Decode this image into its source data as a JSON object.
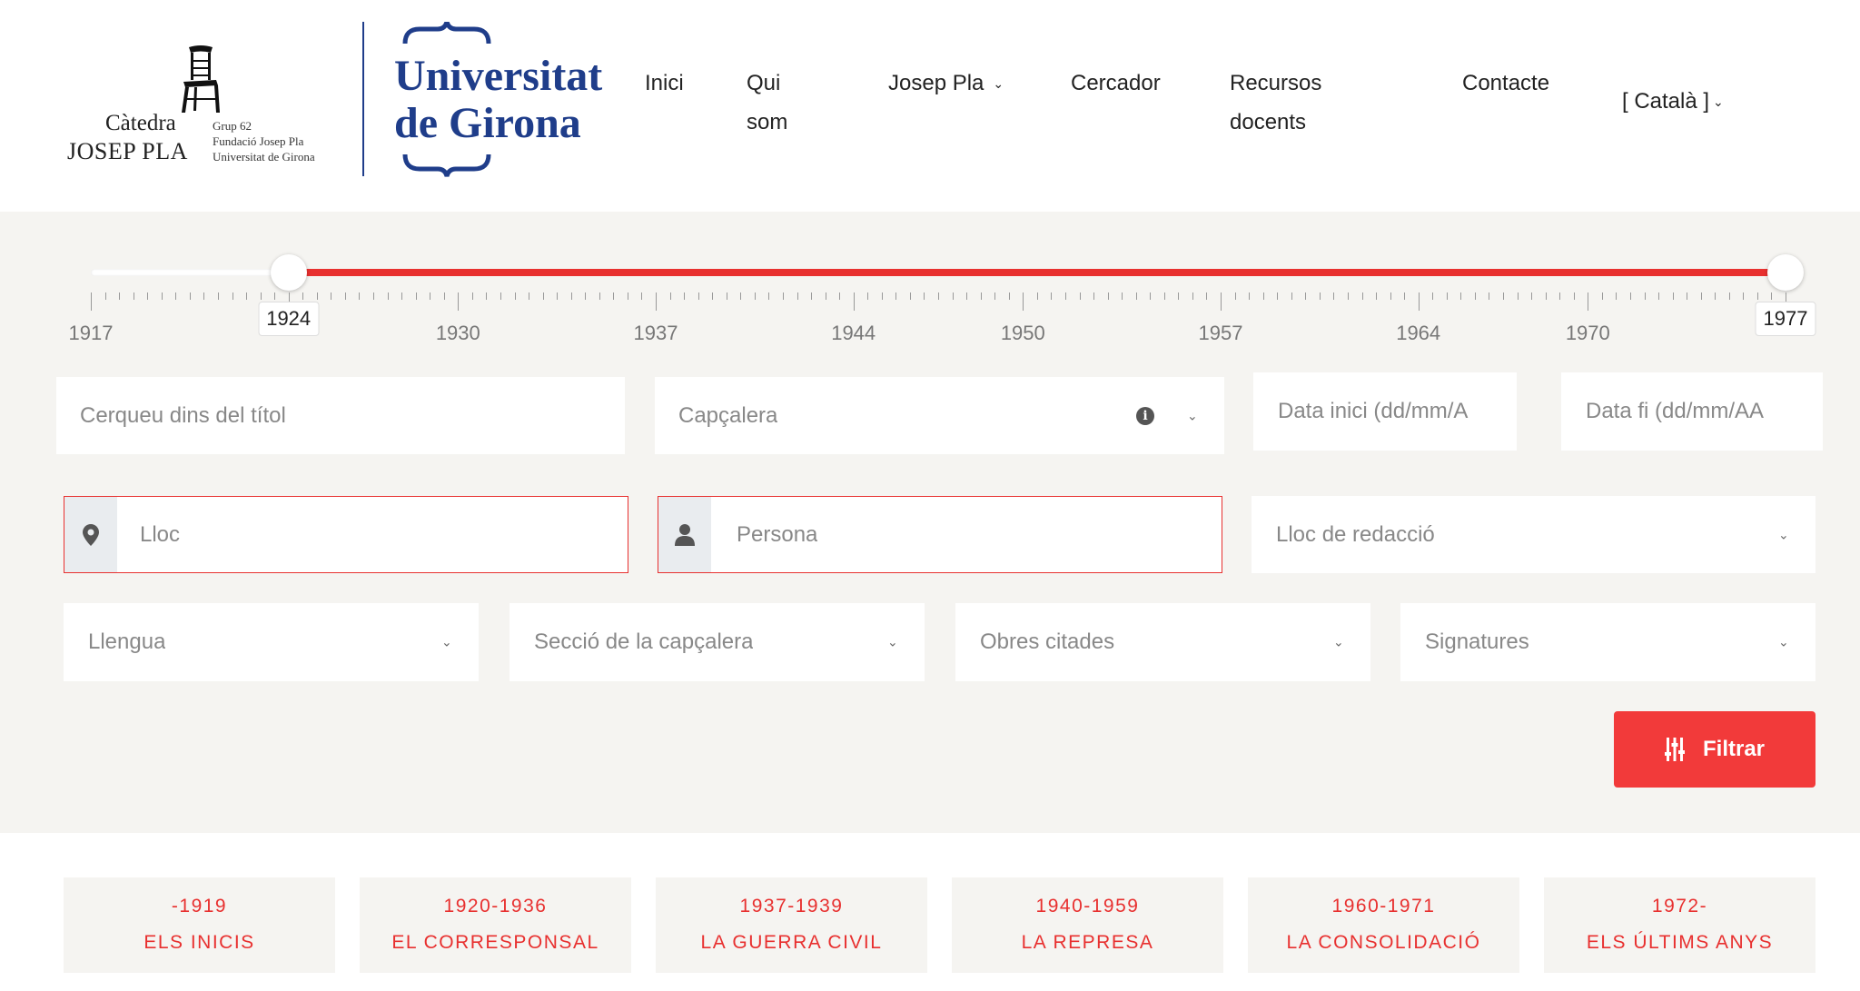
{
  "header": {
    "catedra": {
      "title": "Càtedra",
      "name": "JOSEP PLA",
      "sub_lines": [
        "Grup 62",
        "Fundació Josep Pla",
        "Universitat de Girona"
      ]
    },
    "university": {
      "line1": "Universitat",
      "line2": "de Girona"
    },
    "nav": [
      {
        "label": "Inici"
      },
      {
        "label_line1": "Qui",
        "label_line2": "som"
      },
      {
        "label": "Josep Pla"
      },
      {
        "label": "Cercador"
      },
      {
        "label_line1": "Recursos",
        "label_line2": "docents"
      },
      {
        "label": "Contacte"
      }
    ],
    "language": "[ Català ]"
  },
  "timeline": {
    "min": 1917,
    "max": 1977,
    "selected_from": 1924,
    "selected_to": 1977,
    "tick_labels": [
      "1917",
      "1924",
      "1930",
      "1937",
      "1944",
      "1950",
      "1957",
      "1964",
      "1970",
      "1977"
    ],
    "from_label": "1924",
    "to_label": "1977",
    "accent_color": "#e8302f"
  },
  "filters": {
    "title_search": {
      "placeholder": "Cerqueu dins del títol"
    },
    "header_select": {
      "placeholder": "Capçalera"
    },
    "date_start": {
      "placeholder": "Data inici (dd/mm/A"
    },
    "date_end": {
      "placeholder": "Data fi (dd/mm/AA"
    },
    "place": {
      "placeholder": "Lloc"
    },
    "person": {
      "placeholder": "Persona"
    },
    "writing_place": {
      "placeholder": "Lloc de redacció"
    },
    "language": {
      "placeholder": "Llengua"
    },
    "section": {
      "placeholder": "Secció de la capçalera"
    },
    "works": {
      "placeholder": "Obres citades"
    },
    "signatures": {
      "placeholder": "Signatures"
    },
    "filter_button": "Filtrar"
  },
  "periods": [
    {
      "years": "-1919",
      "name": "ELS INICIS"
    },
    {
      "years": "1920-1936",
      "name": "EL CORRESPONSAL"
    },
    {
      "years": "1937-1939",
      "name": "LA GUERRA CIVIL"
    },
    {
      "years": "1940-1959",
      "name": "LA REPRESA"
    },
    {
      "years": "1960-1971",
      "name": "LA CONSOLIDACIÓ"
    },
    {
      "years": "1972-",
      "name": "ELS ÚLTIMS ANYS"
    }
  ]
}
